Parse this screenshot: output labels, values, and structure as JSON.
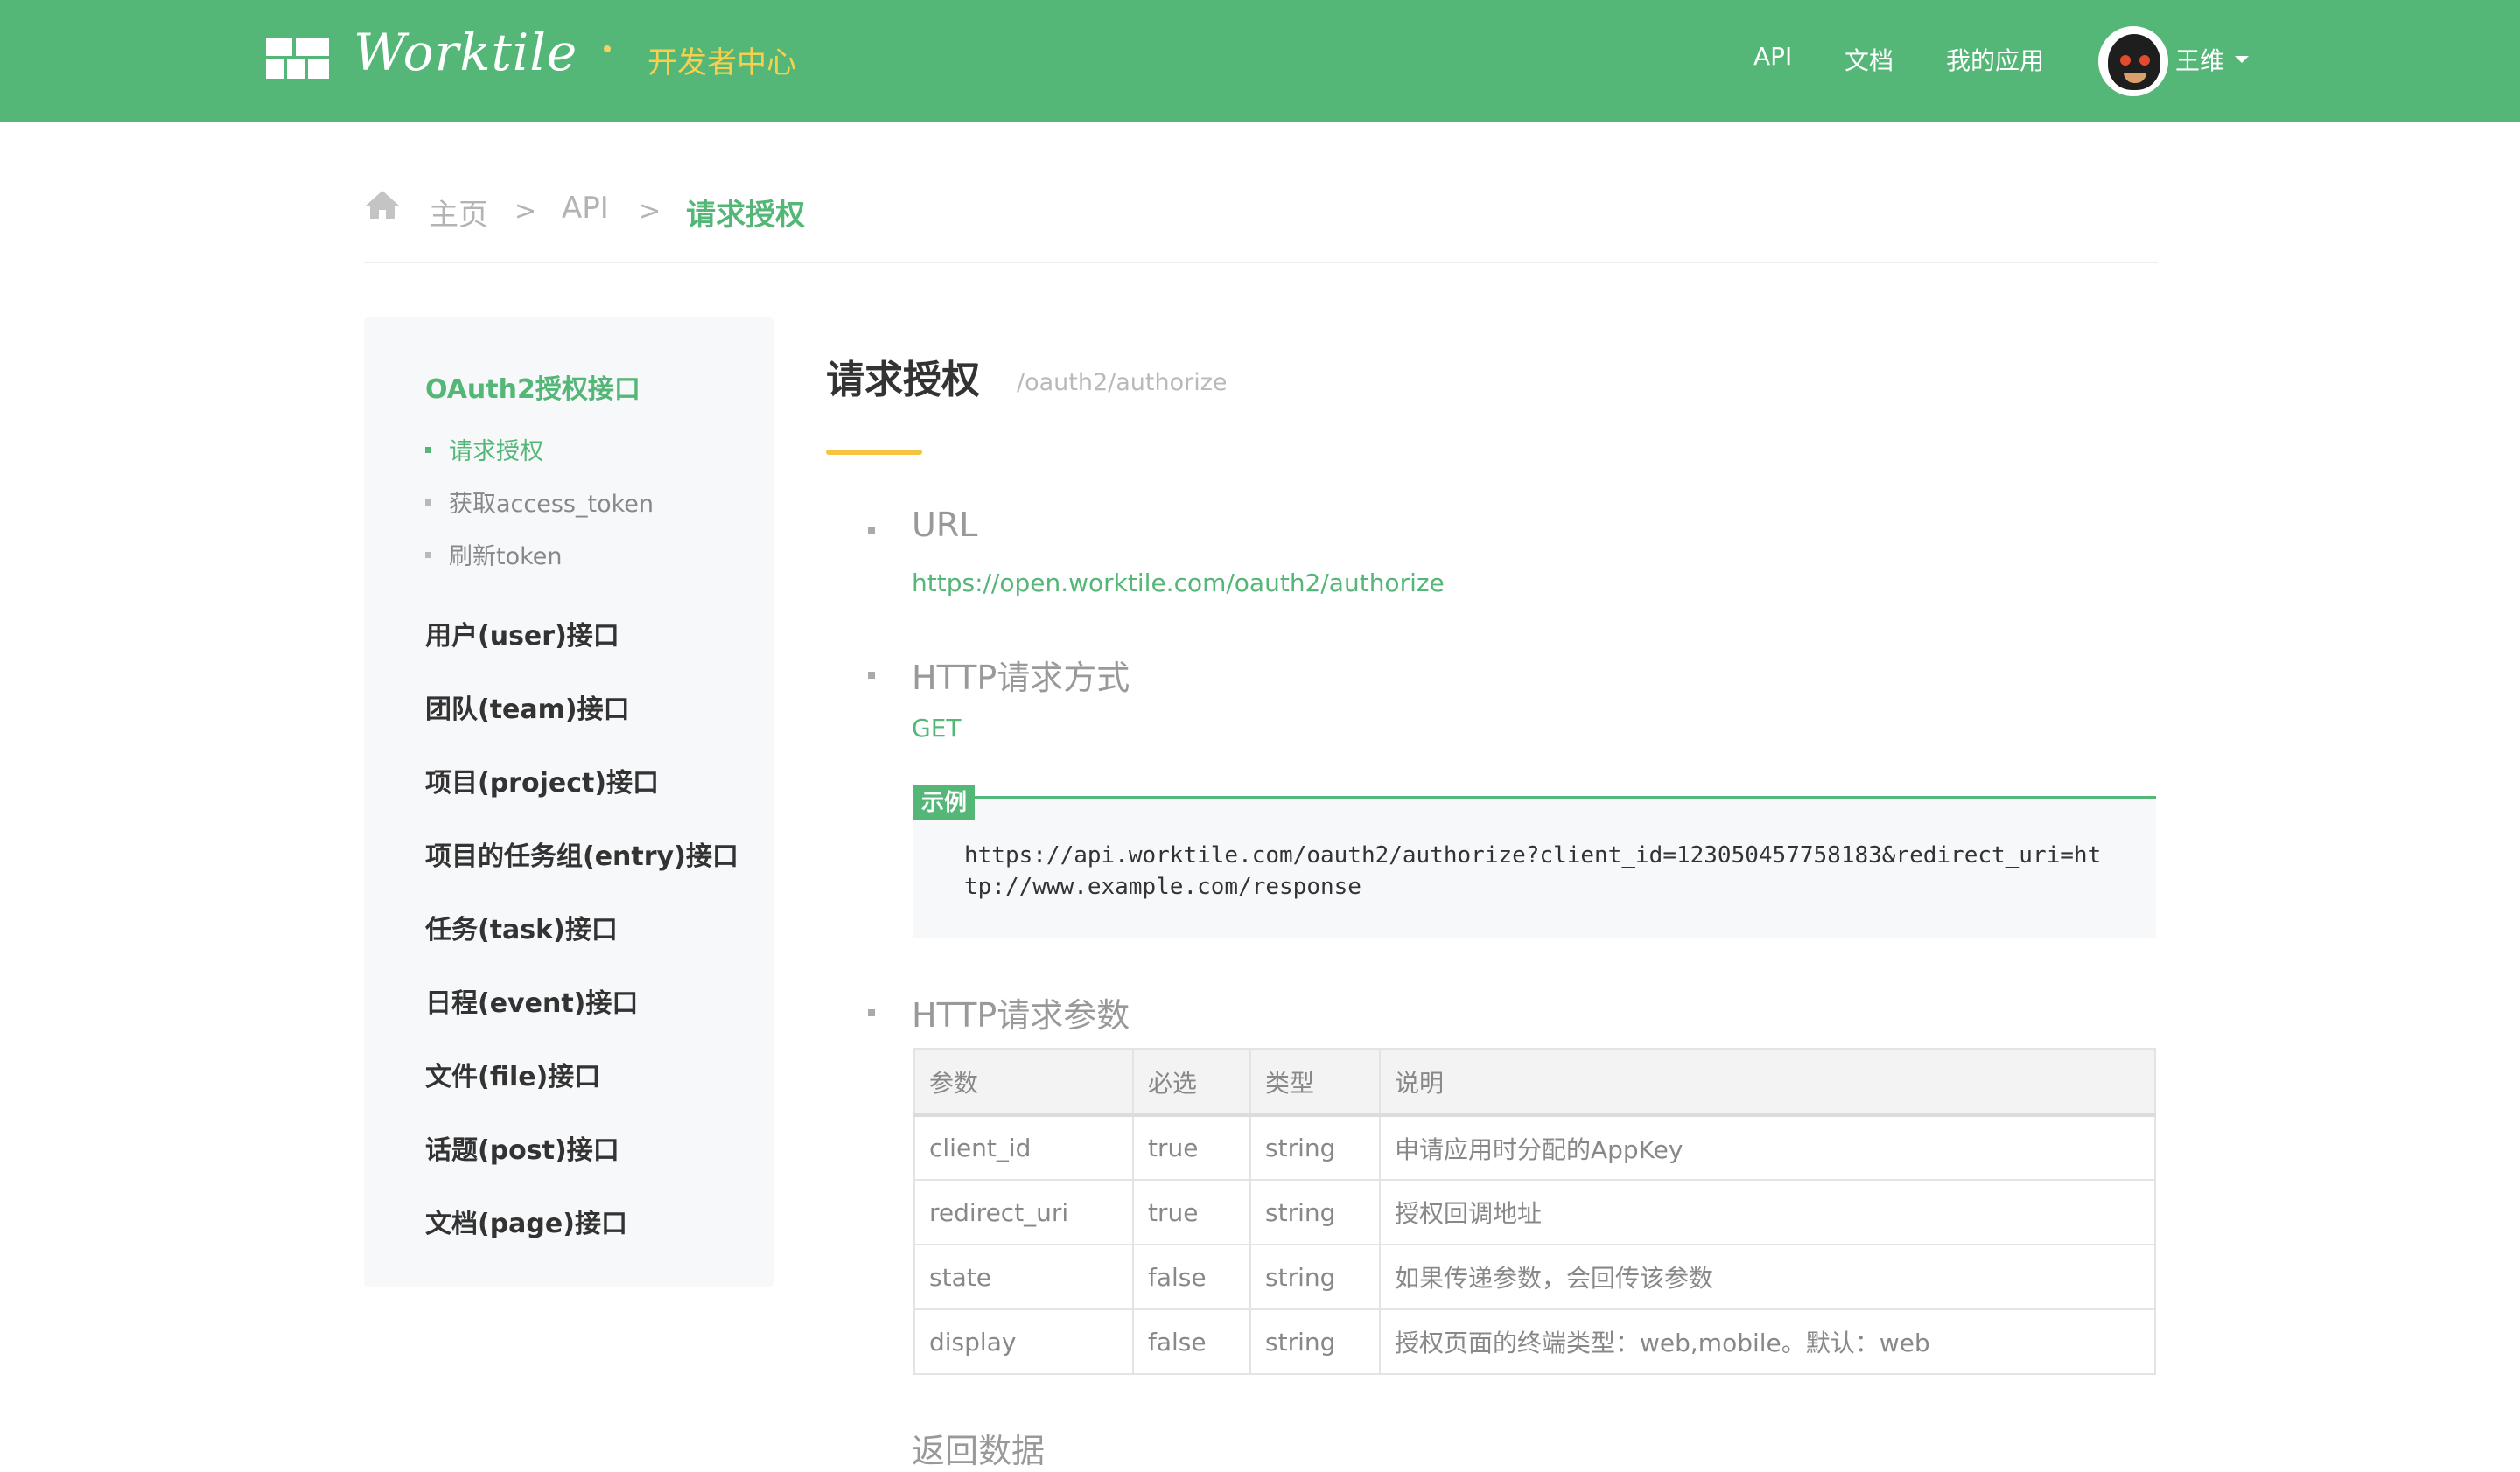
{
  "header": {
    "logo_text": "Worktile",
    "dev_center": "开发者中心",
    "nav": {
      "api": "API",
      "docs": "文档",
      "apps": "我的应用"
    },
    "user_name": "王维"
  },
  "breadcrumb": {
    "home": "主页",
    "sep": ">",
    "api": "API",
    "current": "请求授权"
  },
  "sidebar": {
    "active_group": "OAuth2授权接口",
    "sub_items": [
      "请求授权",
      "获取access_token",
      "刷新token"
    ],
    "groups": [
      "用户(user)接口",
      "团队(team)接口",
      "项目(project)接口",
      "项目的任务组(entry)接口",
      "任务(task)接口",
      "日程(event)接口",
      "文件(file)接口",
      "话题(post)接口",
      "文档(page)接口"
    ]
  },
  "main": {
    "title": "请求授权",
    "path": "/oauth2/authorize",
    "url_title": "URL",
    "url_value": "https://open.worktile.com/oauth2/authorize",
    "method_title": "HTTP请求方式",
    "method_value": "GET",
    "example_label": "示例",
    "example_code": "https://api.worktile.com/oauth2/authorize?client_id=123050457758183&redirect_uri=http://www.example.com/response",
    "params_title": "HTTP请求参数",
    "table_headers": [
      "参数",
      "必选",
      "类型",
      "说明"
    ],
    "table_rows": [
      [
        "client_id",
        "true",
        "string",
        "申请应用时分配的AppKey"
      ],
      [
        "redirect_uri",
        "true",
        "string",
        "授权回调地址"
      ],
      [
        "state",
        "false",
        "string",
        "如果传递参数，会回传该参数"
      ],
      [
        "display",
        "false",
        "string",
        "授权页面的终端类型：web,mobile。默认：web"
      ]
    ],
    "return_title": "返回数据"
  },
  "colors": {
    "brand_green": "#54b777",
    "accent_yellow": "#f5c542"
  }
}
